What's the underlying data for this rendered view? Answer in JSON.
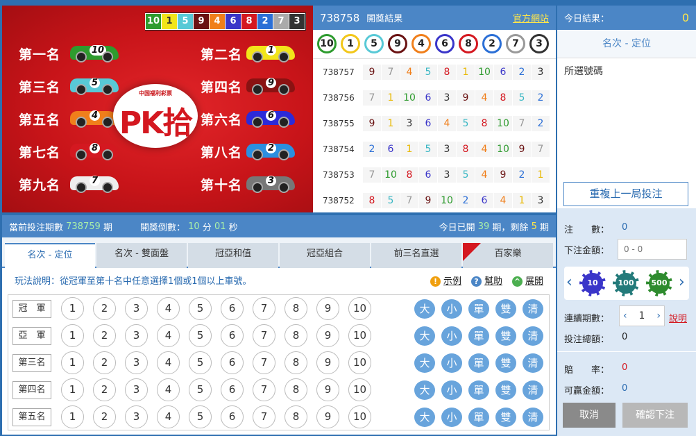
{
  "race": {
    "top_balls": [
      {
        "n": "10",
        "c": "#2e9b2e"
      },
      {
        "n": "1",
        "c": "#f2e51a"
      },
      {
        "n": "5",
        "c": "#58c9d6"
      },
      {
        "n": "9",
        "c": "#6a1212"
      },
      {
        "n": "4",
        "c": "#f07f1b"
      },
      {
        "n": "6",
        "c": "#3a35c9"
      },
      {
        "n": "8",
        "c": "#d41820"
      },
      {
        "n": "2",
        "c": "#2b6fd6"
      },
      {
        "n": "7",
        "c": "#aaaaaa"
      },
      {
        "n": "3",
        "c": "#333333"
      }
    ],
    "ranks": [
      "第一名",
      "第二名",
      "第三名",
      "第四名",
      "第五名",
      "第六名",
      "第七名",
      "第八名",
      "第九名",
      "第十名"
    ],
    "cars": [
      {
        "n": "10",
        "c": "#2e9b2e"
      },
      {
        "n": "1",
        "c": "#f2e51a"
      },
      {
        "n": "5",
        "c": "#58c9d6"
      },
      {
        "n": "9",
        "c": "#8a1212"
      },
      {
        "n": "4",
        "c": "#f07f1b"
      },
      {
        "n": "6",
        "c": "#2c2ad8"
      },
      {
        "n": "8",
        "c": "#d41820"
      },
      {
        "n": "2",
        "c": "#2b8fe0"
      },
      {
        "n": "7",
        "c": "#eeeeee"
      },
      {
        "n": "3",
        "c": "#777777"
      }
    ],
    "logo_sub": "中国福利彩票",
    "logo_main": "PK拾"
  },
  "results": {
    "period": "738758",
    "title": "開獎結果",
    "site_link": "官方網站",
    "header_balls": [
      {
        "n": "10",
        "c": "#2e9b2e"
      },
      {
        "n": "1",
        "c": "#f2c71a"
      },
      {
        "n": "5",
        "c": "#58c9d6"
      },
      {
        "n": "9",
        "c": "#6a1212"
      },
      {
        "n": "4",
        "c": "#f07f1b"
      },
      {
        "n": "6",
        "c": "#3a35c9"
      },
      {
        "n": "8",
        "c": "#d41820"
      },
      {
        "n": "2",
        "c": "#2b6fd6"
      },
      {
        "n": "7",
        "c": "#999999"
      },
      {
        "n": "3",
        "c": "#333333"
      }
    ],
    "rows": [
      {
        "period": "738757",
        "nums": [
          "9",
          "7",
          "4",
          "5",
          "8",
          "1",
          "10",
          "6",
          "2",
          "3"
        ]
      },
      {
        "period": "738756",
        "nums": [
          "7",
          "1",
          "10",
          "6",
          "3",
          "9",
          "4",
          "8",
          "5",
          "2"
        ]
      },
      {
        "period": "738755",
        "nums": [
          "9",
          "1",
          "3",
          "6",
          "4",
          "5",
          "8",
          "10",
          "7",
          "2"
        ]
      },
      {
        "period": "738754",
        "nums": [
          "2",
          "6",
          "1",
          "5",
          "3",
          "8",
          "4",
          "10",
          "9",
          "7"
        ]
      },
      {
        "period": "738753",
        "nums": [
          "7",
          "10",
          "8",
          "6",
          "3",
          "5",
          "4",
          "9",
          "2",
          "1"
        ]
      },
      {
        "period": "738752",
        "nums": [
          "8",
          "5",
          "7",
          "9",
          "10",
          "2",
          "6",
          "4",
          "1",
          "3"
        ]
      }
    ],
    "num_colors": {
      "1": "#e8b800",
      "2": "#2b6fd6",
      "3": "#333333",
      "4": "#f07f1b",
      "5": "#3ab7c4",
      "6": "#3a35c9",
      "7": "#999999",
      "8": "#d41820",
      "9": "#6a1212",
      "10": "#2e9b2e"
    }
  },
  "status": {
    "current_label": "當前投注期數",
    "current_period": "738759",
    "period_unit": "期",
    "countdown_label": "開獎倒數：",
    "minutes": "10",
    "min_unit": "分",
    "seconds": "01",
    "sec_unit": "秒",
    "today_prefix": "今日已開",
    "today_count": "39",
    "today_mid": "期，剩餘",
    "remaining": "5",
    "remaining_unit": "期"
  },
  "tabs": [
    "名次 - 定位",
    "名次 - 雙面盤",
    "冠亞和值",
    "冠亞組合",
    "前三名直選",
    "百家樂"
  ],
  "tab_badge": "New",
  "help": {
    "text": "玩法說明：從冠軍至第十名中任意選擇1個或1個以上車號。",
    "example": "示例",
    "help": "幫助",
    "expand": "展開"
  },
  "bet_rows": [
    "冠　軍",
    "亞　軍",
    "第三名",
    "第四名",
    "第五名"
  ],
  "numbers": [
    "1",
    "2",
    "3",
    "4",
    "5",
    "6",
    "7",
    "8",
    "9",
    "10"
  ],
  "ops": [
    "大",
    "小",
    "單",
    "雙",
    "清"
  ],
  "right": {
    "today_label": "今日結果：",
    "today_value": "0",
    "mode": "名次 - 定位",
    "picked_label": "所選號碼",
    "repeat": "重複上一局投注",
    "notes_label": "注　　數：",
    "notes_value": "0",
    "amount_label": "下注金額：",
    "amount_placeholder": "0 - 0",
    "chips": [
      "10",
      "100",
      "500"
    ],
    "continuous_label": "連續期數：",
    "continuous_value": "1",
    "explain": "說明",
    "total_label": "投注總額：",
    "total_value": "0",
    "odds_label": "賠　　率：",
    "odds_value": "0",
    "win_label": "可贏金額：",
    "win_value": "0",
    "cancel": "取消",
    "confirm": "確認下注"
  }
}
